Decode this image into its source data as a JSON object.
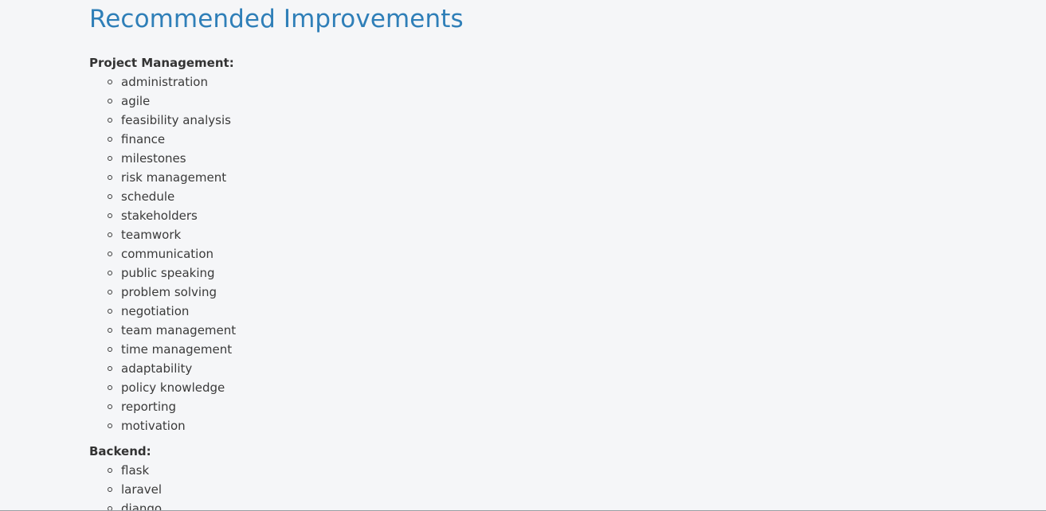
{
  "page": {
    "title": "Recommended Improvements"
  },
  "sections": [
    {
      "title": "Project Management:",
      "items": [
        "administration",
        "agile",
        "feasibility analysis",
        "finance",
        "milestones",
        "risk management",
        "schedule",
        "stakeholders",
        "teamwork",
        "communication",
        "public speaking",
        "problem solving",
        "negotiation",
        "team management",
        "time management",
        "adaptability",
        "policy knowledge",
        "reporting",
        "motivation"
      ]
    },
    {
      "title": "Backend:",
      "items": [
        "flask",
        "laravel",
        "django"
      ]
    }
  ],
  "colors": {
    "title": "#2f7fb8",
    "text": "#333333",
    "background": "#f5f6f8"
  },
  "icons": {
    "list_bullet": "circle-outline"
  }
}
